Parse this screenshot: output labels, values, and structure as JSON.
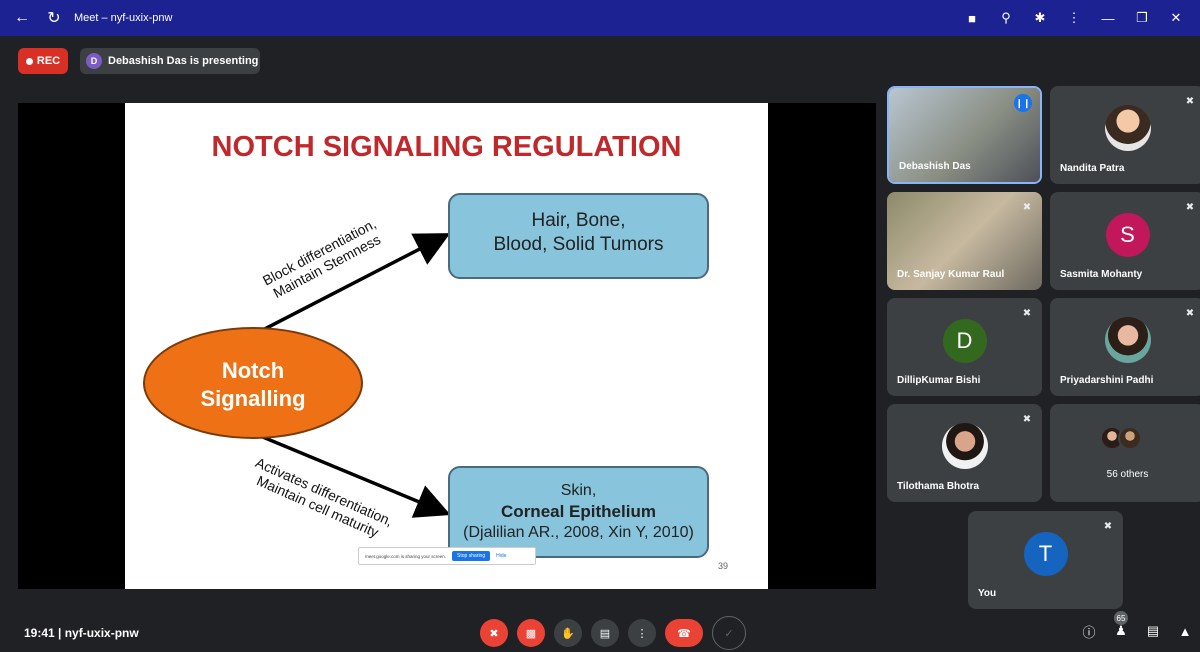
{
  "browser": {
    "title": "Meet – nyf-uxix-pnw"
  },
  "recording": {
    "rec_label": "REC",
    "presenter_initial": "D",
    "presenting_text": "Debashish Das is presenting"
  },
  "slide": {
    "title": "NOTCH SIGNALING REGULATION",
    "center_line1": "Notch",
    "center_line2": "Signalling",
    "upper_label_line1": "Block differentiation,",
    "upper_label_line2": "Maintain Stemness",
    "lower_label_line1": "Activates differentiation,",
    "lower_label_line2": "Maintain cell maturity",
    "box1_line1": "Hair, Bone,",
    "box1_line2": "Blood, Solid Tumors",
    "box2_line1": "Skin,",
    "box2_line2": "Corneal Epithelium",
    "box2_line3": "(Djalilian AR., 2008, Xin Y, 2010)",
    "page_number": "39"
  },
  "share_bar": {
    "text": "meet.google.com is sharing your screen.",
    "stop_label": "Stop sharing",
    "hide_label": "Hide"
  },
  "participants": [
    {
      "name": "Debashish Das"
    },
    {
      "name": "Nandita Patra"
    },
    {
      "name": "Dr. Sanjay Kumar Raul"
    },
    {
      "name": "Sasmita Mohanty",
      "initial": "S",
      "color": "#c2185b"
    },
    {
      "name": "DillipKumar Bishi",
      "initial": "D",
      "color": "#33691e"
    },
    {
      "name": "Priyadarshini Padhi"
    },
    {
      "name": "Tilothama Bhotra"
    },
    {
      "name": "56 others"
    },
    {
      "name": "You",
      "initial": "T",
      "color": "#1565c0"
    }
  ],
  "bottom": {
    "meeting_info": "19:41 | nyf-uxix-pnw",
    "participant_count": "65"
  }
}
